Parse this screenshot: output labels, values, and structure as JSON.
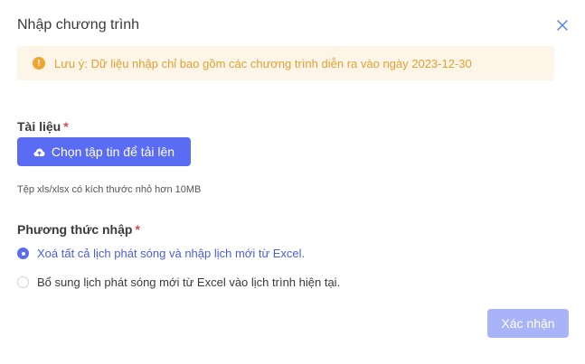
{
  "dialog": {
    "title": "Nhập chương trình",
    "close_icon": "close-icon"
  },
  "alert": {
    "icon": "warning-icon",
    "icon_glyph": "!",
    "text": "Lưu ý: Dữ liệu nhập chỉ bao gồm các chương trình diễn ra vào ngày 2023-12-30",
    "color": "#e3a130",
    "background": "#fdf5e8"
  },
  "document": {
    "label": "Tài liệu",
    "required_mark": "*",
    "upload_icon": "cloud-upload-icon",
    "upload_label": "Chọn tập tin để tải lên",
    "hint": "Tệp xls/xlsx có kích thước nhỏ hơn 10MB"
  },
  "import_method": {
    "label": "Phương thức nhập",
    "required_mark": "*",
    "options": [
      {
        "label": "Xoá tất cả lịch phát sóng và nhập lịch mới từ Excel.",
        "selected": true
      },
      {
        "label": "Bổ sung lịch phát sóng mới từ Excel vào lịch trình hiện tại.",
        "selected": false
      }
    ]
  },
  "footer": {
    "confirm_label": "Xác nhận"
  },
  "colors": {
    "primary": "#5a6cf4",
    "primary_disabled": "#a9b3f8",
    "required": "#e0474b"
  }
}
